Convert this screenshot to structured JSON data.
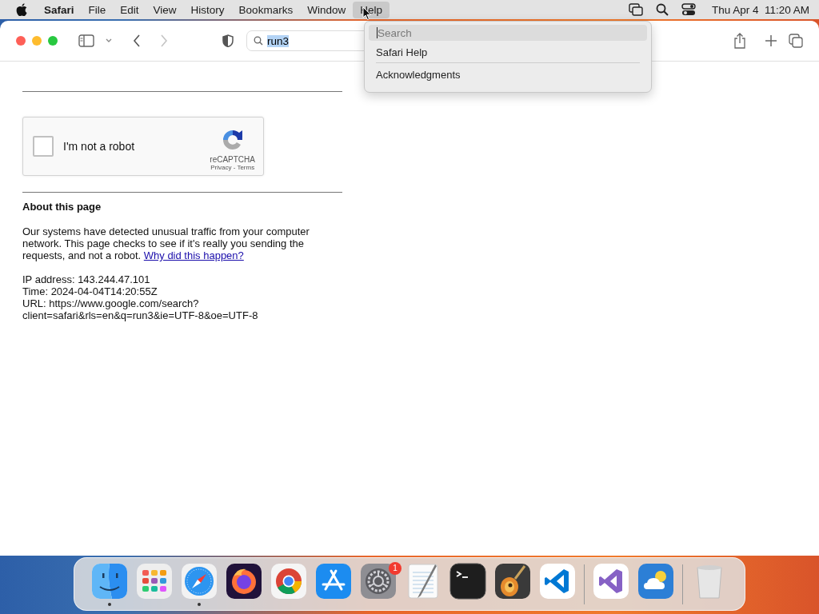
{
  "menu_bar": {
    "app_name": "Safari",
    "items": [
      {
        "label": "File",
        "selected": false
      },
      {
        "label": "Edit",
        "selected": false
      },
      {
        "label": "View",
        "selected": false
      },
      {
        "label": "History",
        "selected": false
      },
      {
        "label": "Bookmarks",
        "selected": false
      },
      {
        "label": "Window",
        "selected": false
      },
      {
        "label": "Help",
        "selected": true
      }
    ],
    "clock": "Thu Apr 4  11:20 AM"
  },
  "toolbar": {
    "address": {
      "value": "run3",
      "text_selected": true
    },
    "forward_disabled": true
  },
  "help_menu": {
    "search": {
      "placeholder": "Search"
    },
    "items": [
      "Safari Help",
      "Acknowledgments"
    ]
  },
  "page": {
    "captcha": {
      "label": "I'm not a robot",
      "checked": false,
      "brand": "reCAPTCHA",
      "privacy": "Privacy",
      "separator": "-",
      "terms": "Terms"
    },
    "heading": "About this page",
    "paragraph": "Our systems have detected unusual traffic from your computer network. This page checks to see if it's really you sending the requests, and not a robot.",
    "link": "Why did this happen?",
    "details": [
      "IP address: 143.244.47.101",
      "Time: 2024-04-04T14:20:55Z",
      "URL: https://www.google.com/search?",
      "client=safari&rls=en&q=run3&ie=UTF-8&oe=UTF-8"
    ]
  },
  "dock": [
    {
      "kind": "finder",
      "running": true
    },
    {
      "kind": "launchpad",
      "running": false
    },
    {
      "kind": "safari",
      "running": true
    },
    {
      "kind": "firefox",
      "running": false
    },
    {
      "kind": "chrome",
      "running": false
    },
    {
      "kind": "appstore",
      "running": false
    },
    {
      "kind": "settings",
      "running": false,
      "badge": "1"
    },
    {
      "kind": "textedit",
      "running": false
    },
    {
      "kind": "terminal",
      "running": false
    },
    {
      "kind": "garageband",
      "running": false
    },
    {
      "kind": "vscode",
      "running": false
    },
    {
      "kind": "separator"
    },
    {
      "kind": "visualstudio",
      "running": false
    },
    {
      "kind": "weather",
      "running": false
    },
    {
      "kind": "separator"
    },
    {
      "kind": "trash",
      "running": false
    }
  ]
}
